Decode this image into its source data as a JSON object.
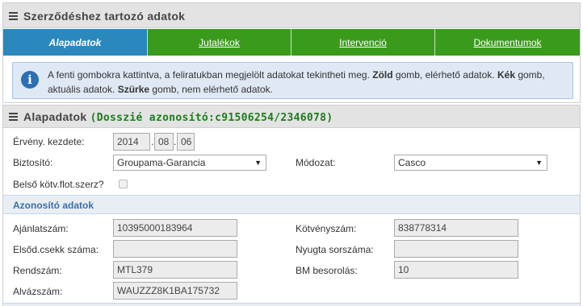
{
  "panel1": {
    "title": "Szerződéshez tartozó adatok",
    "tabs": [
      {
        "label": "Alapadatok"
      },
      {
        "label": "Jutalékok"
      },
      {
        "label": "Intervenció"
      },
      {
        "label": "Dokumentumok"
      }
    ],
    "info": {
      "part1": "A fenti gombokra kattintva, a feliratukban megjelölt adatokat tekintheti meg. ",
      "green_word": "Zöld",
      "part2": " gomb, elérhető adatok. ",
      "blue_word": "Kék",
      "part3": " gomb, aktuális adatok. ",
      "grey_word": "Szürke",
      "part4": " gomb, nem elérhető adatok."
    }
  },
  "panel2": {
    "title": "Alapadatok",
    "dossier": "(Dosszié azonosító:c91506254/2346078)",
    "fields": {
      "ervenykezdete_label": "Érvény. kezdete:",
      "date_year": "2014",
      "date_month": "08",
      "date_day": "06",
      "date_sep": ".",
      "biztosito_label": "Biztosító:",
      "biztosito_value": "Groupama-Garancia",
      "modozat_label": "Módozat:",
      "modozat_value": "Casco",
      "belso_label": "Belső kötv.flot.szerz?"
    },
    "section_title": "Azonosító adatok",
    "ids": {
      "ajanlatszam_label": "Ajánlatszám:",
      "ajanlatszam_value": "10395000183964",
      "kotvenyszam_label": "Kötvényszám:",
      "kotvenyszam_value": "838778314",
      "elsod_label": "Elsőd.csekk száma:",
      "elsod_value": "",
      "nyugta_label": "Nyugta sorszáma:",
      "nyugta_value": "",
      "rendszam_label": "Rendszám:",
      "rendszam_value": "MTL379",
      "bm_label": "BM besorolás:",
      "bm_value": "10",
      "alvaz_label": "Alvázszám:",
      "alvaz_value": "WAUZZZ8K1BA175732"
    }
  },
  "icons": {
    "menu": "hamburger-icon",
    "info": "info-icon",
    "dropdown": "chevron-down-icon"
  },
  "colors": {
    "active_tab": "#2a88bd",
    "inactive_tab": "#3a9a1c",
    "dossier_text": "#1c7d1c",
    "section_text": "#3b6fa6"
  }
}
